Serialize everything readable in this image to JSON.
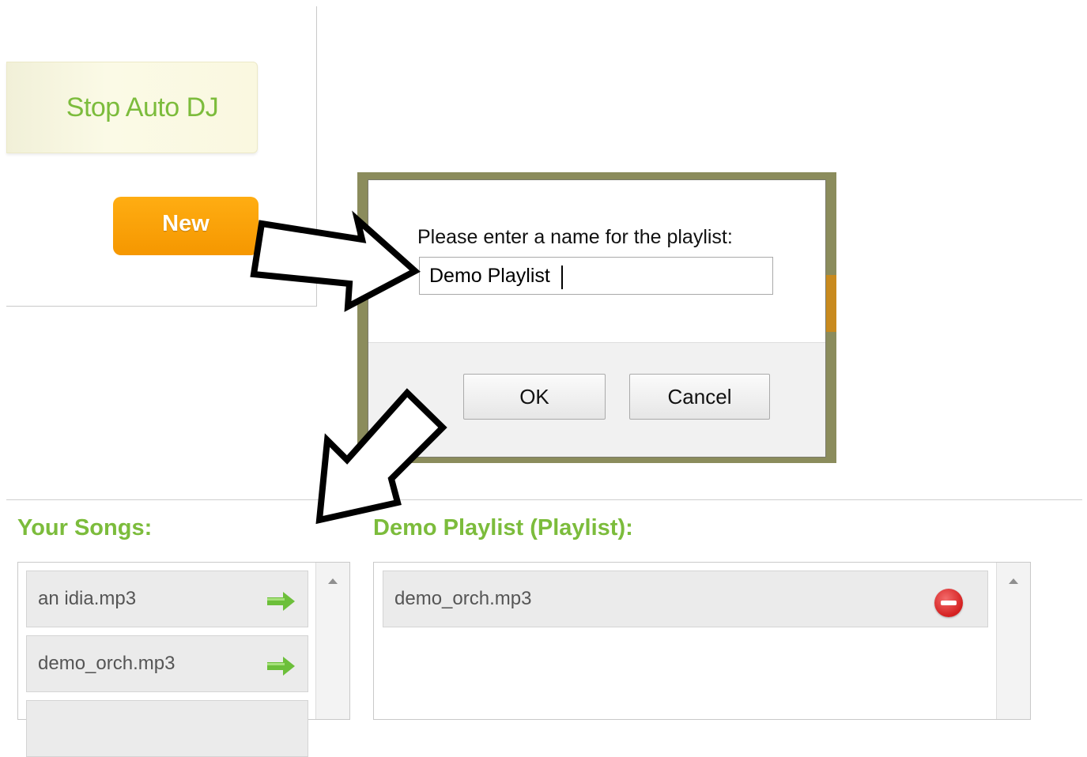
{
  "controls": {
    "stop_auto_dj_label": "Stop Auto DJ",
    "new_label": "New"
  },
  "dialog": {
    "message": "Please enter a name for the playlist:",
    "input_value": "Demo Playlist",
    "ok_label": "OK",
    "cancel_label": "Cancel"
  },
  "songs": {
    "heading": "Your Songs:",
    "items": [
      {
        "name": "an idia.mp3",
        "icon": "green-right-arrow-icon"
      },
      {
        "name": "demo_orch.mp3",
        "icon": "green-right-arrow-icon"
      },
      {
        "name": "",
        "icon": ""
      }
    ]
  },
  "playlist": {
    "heading": "Demo Playlist (Playlist):",
    "items": [
      {
        "name": "demo_orch.mp3",
        "icon": "remove-icon"
      }
    ]
  },
  "colors": {
    "accent_green": "#7cbc3c",
    "new_button_orange": "#f7a000",
    "remove_red": "#d42020"
  }
}
